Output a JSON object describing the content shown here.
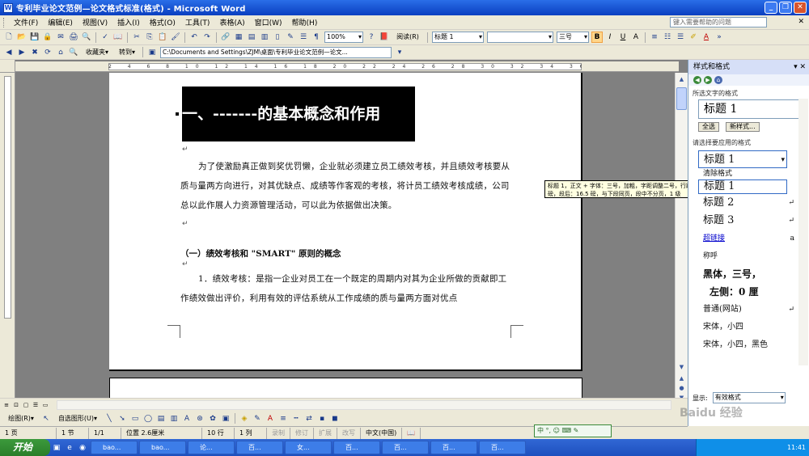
{
  "window": {
    "title": "专利毕业论文范例—论文格式标准(格式) - Microsoft Word"
  },
  "menu": {
    "items": [
      "文件(F)",
      "编辑(E)",
      "视图(V)",
      "插入(I)",
      "格式(O)",
      "工具(T)",
      "表格(A)",
      "窗口(W)",
      "帮助(H)"
    ],
    "help_placeholder": "键入需要帮助的问题"
  },
  "toolbar1": {
    "zoom": "100%",
    "reading": "阅读(R)",
    "style": "标题 1",
    "font": "",
    "size": "三号",
    "bold": "B",
    "italic": "I",
    "underline": "U",
    "font_color_label": "A"
  },
  "toolbar2": {
    "path": "C:\\Documents and Settings\\ZJM\\桌面\\专利毕业论文范例—论文..."
  },
  "document": {
    "heading": "一、-------的基本概念和作用",
    "para1": "为了使激励真正做到奖优罚懒，企业就必须建立员工绩效考核，并且绩效考核要从质与量两方向进行，对其优缺点、成绩等作客观的考核，将计员工绩效考核成绩，公司总以此作展人力资源管理活动，可以此为依据做出决策。",
    "subheading": "（一）绩效考核和 \"SMART\" 原则的概念",
    "para2": "1．绩效考核：是指一企业对员工在一个既定的周期内对其为企业所做的贡献即工作绩效做出评价，利用有效的评估系统从工作成绩的质与量两方面对优点"
  },
  "taskpane": {
    "title": "样式和格式",
    "selected_label": "所选文字的格式",
    "selected_style": "标题 1",
    "select_all": "全选",
    "new_style": "新样式...",
    "apply_label": "请选择要应用的格式",
    "styles": [
      "标题 1",
      "清除格式",
      "标题 1",
      "标题 2",
      "标题 3",
      "超链接",
      "称呼",
      "黑体，三号，",
      "左侧：0 厘",
      "普通(网站)",
      "宋体，小四",
      "宋体，小四，黑色"
    ],
    "style_marks": [
      "",
      "",
      "",
      "↵",
      "↵",
      "a",
      "",
      "",
      "",
      "↵",
      "",
      ""
    ],
    "show_label": "显示:",
    "show_value": "有效格式"
  },
  "tooltip": {
    "text": "标题 1，正文 + 字体：三号，加粗，字距调整二号，行距：多倍行距 2.41 字行，段落间距段前：17 磅，段后：16.5 磅，与下段同页，段中不分页，1 级"
  },
  "statusbar": {
    "page": "1 页",
    "section": "1 节",
    "pages": "1/1",
    "position": "位置 2.6厘米",
    "line": "10 行",
    "col": "1 列",
    "rec": "录制",
    "trk": "修订",
    "ext": "扩展",
    "ovr": "改写",
    "lang": "中文(中国)"
  },
  "taskbar": {
    "start": "开始",
    "items": [
      "bao...",
      "bao...",
      "论...",
      "百...",
      "女...",
      "百...",
      "百...",
      "百...",
      "百...",
      "2...",
      "杨...",
      "标..."
    ],
    "time": "11:41"
  },
  "ime": {
    "text": "中 °, ☺ ⌨ ✎"
  },
  "watermark": {
    "text": "Baidu 经验"
  }
}
